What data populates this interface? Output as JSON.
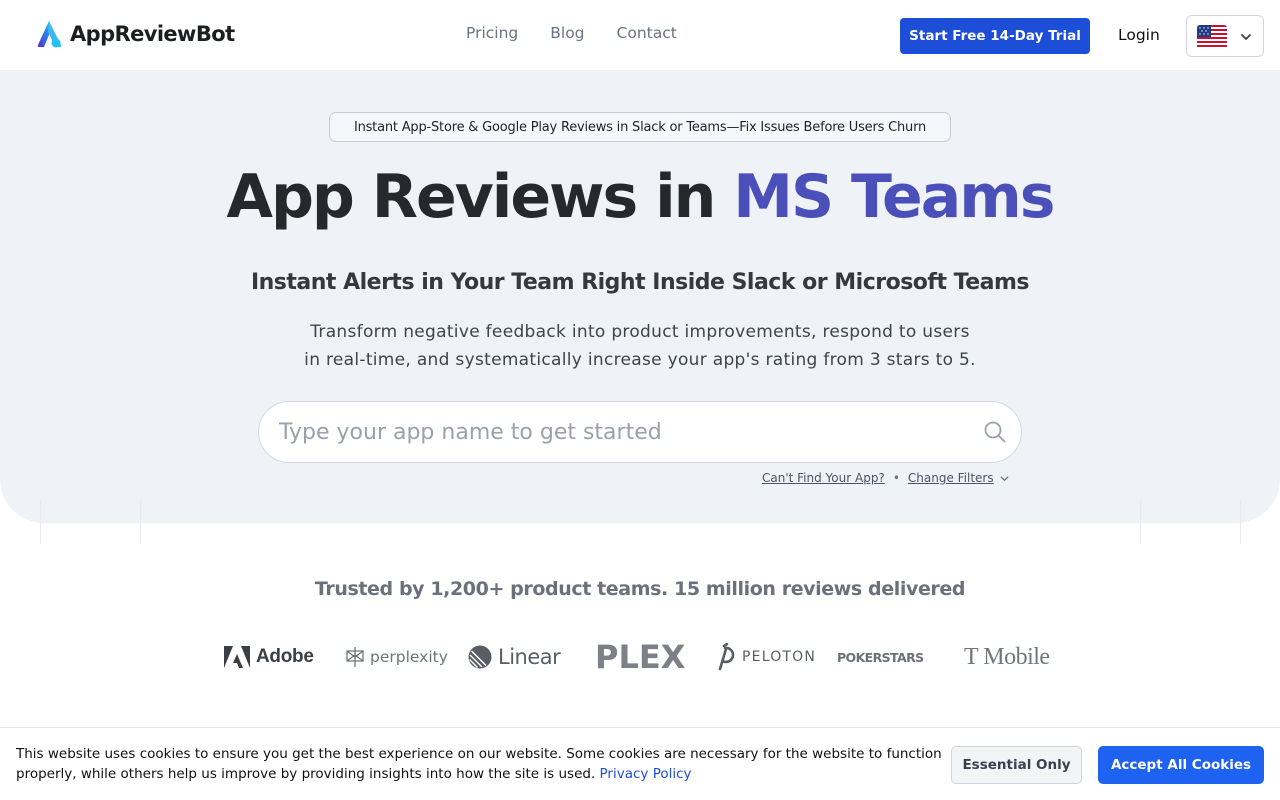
{
  "header": {
    "brand": "AppReviewBot",
    "nav": [
      "Pricing",
      "Blog",
      "Contact"
    ],
    "trial_label": "Start Free 14-Day Trial",
    "login_label": "Login",
    "language_flag": "us-flag-icon"
  },
  "hero": {
    "pill": "Instant App-Store & Google Play Reviews in Slack or Teams—Fix Issues Before Users Churn",
    "title_part1": "App Reviews in",
    "title_accent": "MS Teams",
    "subtitle": "Instant Alerts in Your Team Right Inside Slack or Microsoft Teams",
    "description_line1": "Transform negative feedback into product improvements, respond to users",
    "description_line2": "in real-time, and systematically increase your app's rating from 3 stars to 5.",
    "search_placeholder": "Type your app name to get started",
    "cant_find": "Can't Find Your App?",
    "separator": "•",
    "change_filters": "Change Filters"
  },
  "trust": {
    "headline": "Trusted by 1,200+ product teams. 15 million reviews delivered",
    "brands": [
      "Adobe",
      "perplexity",
      "Linear",
      "PLEX",
      "PELOTON",
      "POKERSTARS",
      "T Mobile"
    ]
  },
  "cookie": {
    "text": "This website uses cookies to ensure you get the best experience on our website. Some cookies are necessary for the website to function properly, while others help us improve by providing insights into how the site is used.",
    "policy_link": "Privacy Policy",
    "essential_label": "Essential Only",
    "accept_label": "Accept All Cookies"
  },
  "colors": {
    "primary": "#1d4ed8",
    "accent": "#4a4fb9",
    "hero_bg": "#eff3f8"
  }
}
